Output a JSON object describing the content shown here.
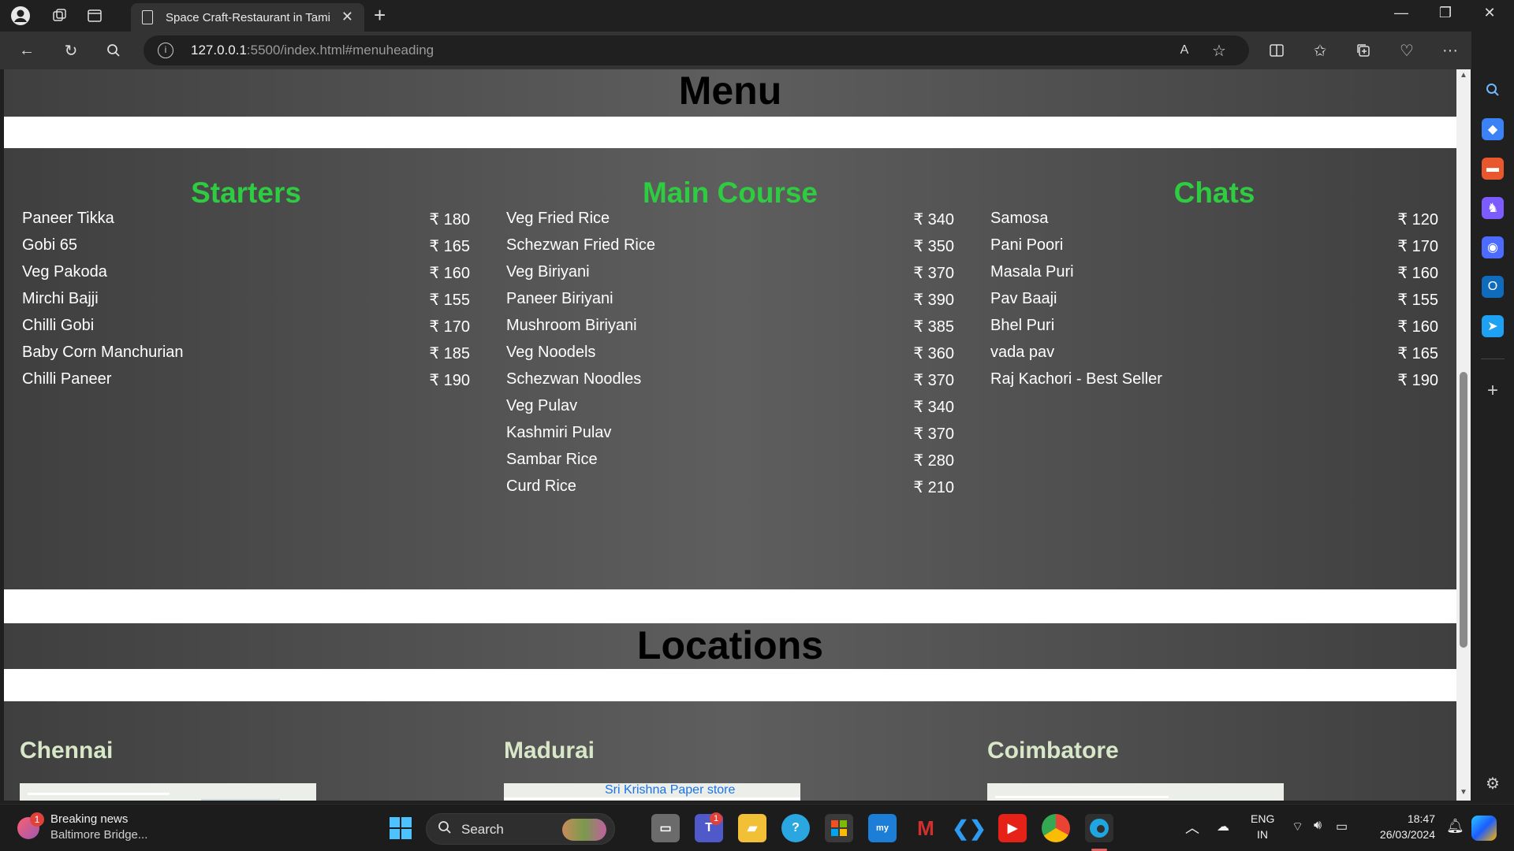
{
  "browser": {
    "tab_title": "Space Craft-Restaurant in Tamilnadu",
    "url_host": "127.0.0.1",
    "url_rest": ":5500/index.html#menuheading"
  },
  "page": {
    "menu_heading": "Menu",
    "locations_heading": "Locations",
    "menu_columns": [
      {
        "title": "Starters",
        "items": [
          {
            "name": "Paneer Tikka",
            "price": "₹ 180"
          },
          {
            "name": "Gobi 65",
            "price": "₹ 165"
          },
          {
            "name": "Veg Pakoda",
            "price": "₹ 160"
          },
          {
            "name": "Mirchi Bajji",
            "price": "₹ 155"
          },
          {
            "name": "Chilli Gobi",
            "price": "₹ 170"
          },
          {
            "name": "Baby Corn Manchurian",
            "price": "₹ 185"
          },
          {
            "name": "Chilli Paneer",
            "price": "₹ 190"
          }
        ]
      },
      {
        "title": "Main Course",
        "items": [
          {
            "name": "Veg Fried Rice",
            "price": "₹ 340"
          },
          {
            "name": "Schezwan Fried Rice",
            "price": "₹ 350"
          },
          {
            "name": "Veg Biriyani",
            "price": "₹ 370"
          },
          {
            "name": "Paneer Biriyani",
            "price": "₹ 390"
          },
          {
            "name": "Mushroom Biriyani",
            "price": "₹ 385"
          },
          {
            "name": "Veg Noodels",
            "price": "₹ 360"
          },
          {
            "name": "Schezwan Noodles",
            "price": "₹ 370"
          },
          {
            "name": "Veg Pulav",
            "price": "₹ 340"
          },
          {
            "name": "Kashmiri Pulav",
            "price": "₹ 370"
          },
          {
            "name": "Sambar Rice",
            "price": "₹ 280"
          },
          {
            "name": "Curd Rice",
            "price": "₹ 210"
          }
        ]
      },
      {
        "title": "Chats",
        "items": [
          {
            "name": "Samosa",
            "price": "₹ 120"
          },
          {
            "name": "Pani Poori",
            "price": "₹ 170"
          },
          {
            "name": "Masala Puri",
            "price": "₹ 160"
          },
          {
            "name": "Pav Baaji",
            "price": "₹ 155"
          },
          {
            "name": "Bhel Puri",
            "price": "₹ 160"
          },
          {
            "name": "vada pav",
            "price": "₹ 165"
          },
          {
            "name": "Raj Kachori - Best Seller",
            "price": "₹ 190"
          }
        ]
      }
    ],
    "locations": [
      {
        "city": "Chennai",
        "map_label": ""
      },
      {
        "city": "Madurai",
        "map_label": "Sri Krishna Paper store"
      },
      {
        "city": "Coimbatore",
        "map_label": ""
      }
    ]
  },
  "taskbar": {
    "news_title": "Breaking news",
    "news_sub": "Baltimore Bridge...",
    "news_badge": "1",
    "search_label": "Search",
    "lang_top": "ENG",
    "lang_bottom": "IN",
    "time": "18:47",
    "date": "26/03/2024",
    "teams_badge": "1"
  },
  "colors": {
    "accent_green": "#2ecc40",
    "city_green": "#d7e7c8",
    "page_dark": "#4f4f4f"
  }
}
